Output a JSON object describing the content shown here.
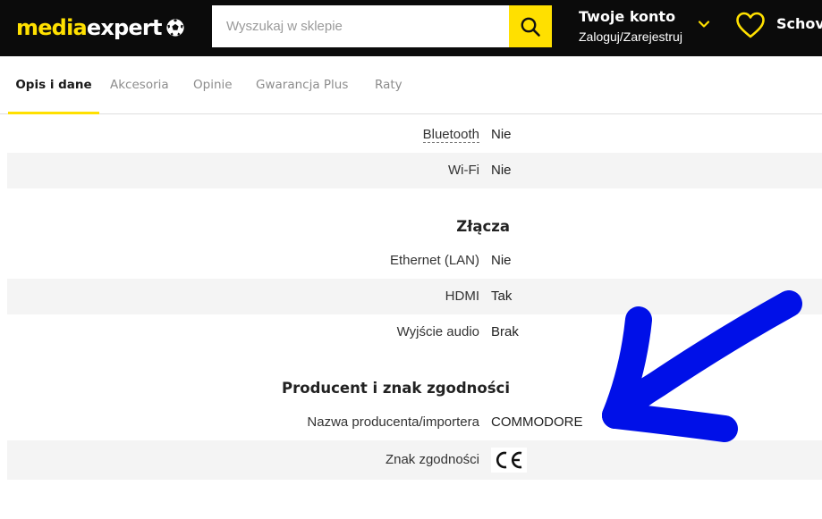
{
  "header": {
    "logo": {
      "media": "media",
      "expert": "expert"
    },
    "search": {
      "placeholder": "Wyszukaj w sklepie"
    },
    "account": {
      "title": "Twoje konto",
      "subtitle": "Zaloguj/Zarejestruj"
    },
    "favorites_label": "Schov"
  },
  "tabs": [
    {
      "label": "Opis i dane",
      "active": true
    },
    {
      "label": "Akcesoria",
      "active": false
    },
    {
      "label": "Opinie",
      "active": false
    },
    {
      "label": "Gwarancja Plus",
      "active": false
    },
    {
      "label": "Raty",
      "active": false
    }
  ],
  "specs": {
    "bluetooth": {
      "label": "Bluetooth",
      "value": "Nie"
    },
    "wifi": {
      "label": "Wi-Fi",
      "value": "Nie"
    },
    "section_connectors": "Złącza",
    "ethernet": {
      "label": "Ethernet (LAN)",
      "value": "Nie"
    },
    "hdmi": {
      "label": "HDMI",
      "value": "Tak"
    },
    "audio": {
      "label": "Wyjście audio",
      "value": "Brak"
    },
    "section_producer": "Producent i znak zgodności",
    "producer": {
      "label": "Nazwa producenta/importera",
      "value": "COMMODORE"
    },
    "conformity": {
      "label": "Znak zgodności",
      "value": "CE"
    }
  },
  "colors": {
    "brand_yellow": "#ffe000",
    "header_bg": "#0b0b0b",
    "annotation_arrow": "#0010e8"
  },
  "icons": [
    "soccer-ball-icon",
    "search-icon",
    "chevron-down-icon",
    "heart-icon",
    "ce-mark-icon"
  ]
}
